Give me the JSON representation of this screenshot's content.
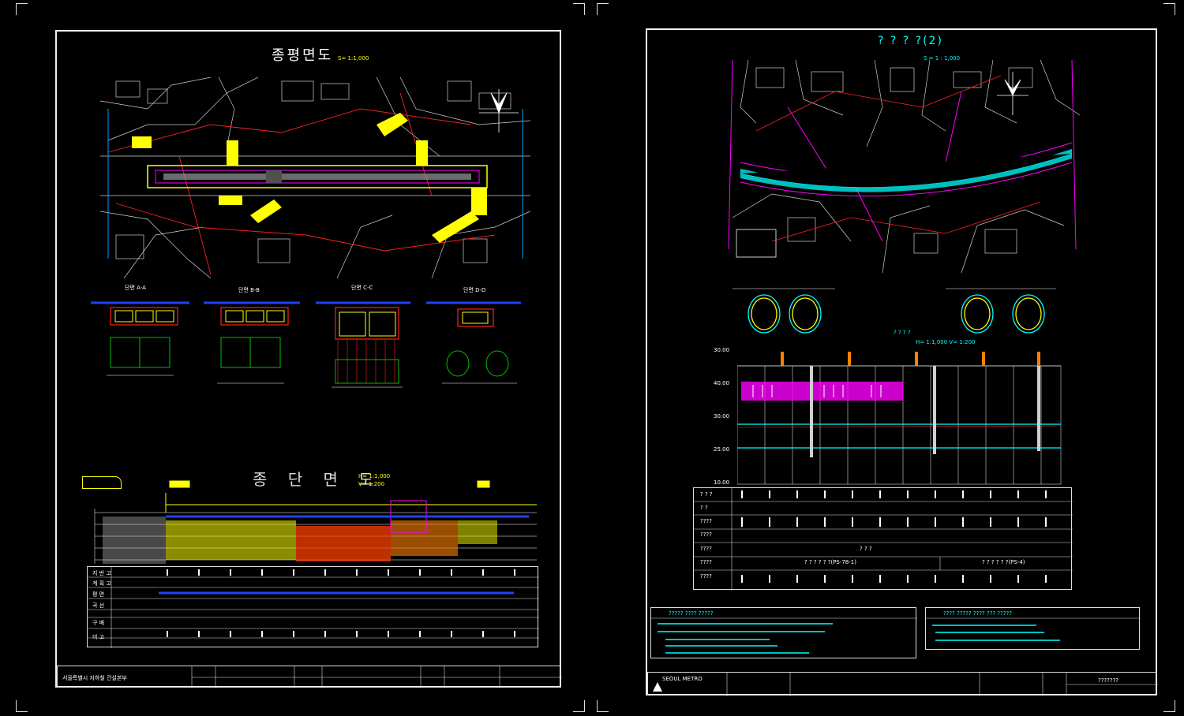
{
  "left_sheet": {
    "plan_title": "종평면도",
    "plan_scale": "S= 1:1,000",
    "sections": [
      "단면 A-A",
      "단면 B-B",
      "단면 C-C",
      "단면 D-D"
    ],
    "profile_title": "종 단 면 도",
    "profile_scale_h": "H= 1:1,000",
    "profile_scale_v": "V= 1:200",
    "profile_rows": [
      "지 반 고",
      "계 획 고",
      "평 면",
      "곡 선",
      "구 배",
      "비 고"
    ],
    "titleblock_text": "서울특별시 지하철 건설본부"
  },
  "right_sheet": {
    "plan_title": "? ? ? ?(2)",
    "plan_scale": "S = 1 : 1,000",
    "profile_label": "? ? ? ?",
    "profile_scale": "H= 1:1,000  V= 1:200",
    "elev_ticks": [
      "30.00",
      "40.00",
      "30.00",
      "25.00",
      "10.00"
    ],
    "table_rows": [
      "? ? ?",
      "?  ?",
      "????",
      "????",
      "????",
      "????",
      "????"
    ],
    "table_texts": [
      "? ? ?",
      "? ? ? ? ? ?(PS-78-1)",
      "? ? ? ? ? ?(PS-4)"
    ],
    "note_left_title": "????? ???? ?????",
    "note_right_title": "???? ????? ???? ??? ?????",
    "title_block_code": "???????",
    "company": "SEOUL METRO"
  },
  "colors": {
    "background": "#000000",
    "border": "#f2f2f2",
    "yellow": "#ffff00",
    "magenta": "#ff00ff",
    "cyan": "#00ffff",
    "red": "#ff2020",
    "green": "#00c000",
    "blue": "#2040ff",
    "orange": "#ff8000"
  }
}
